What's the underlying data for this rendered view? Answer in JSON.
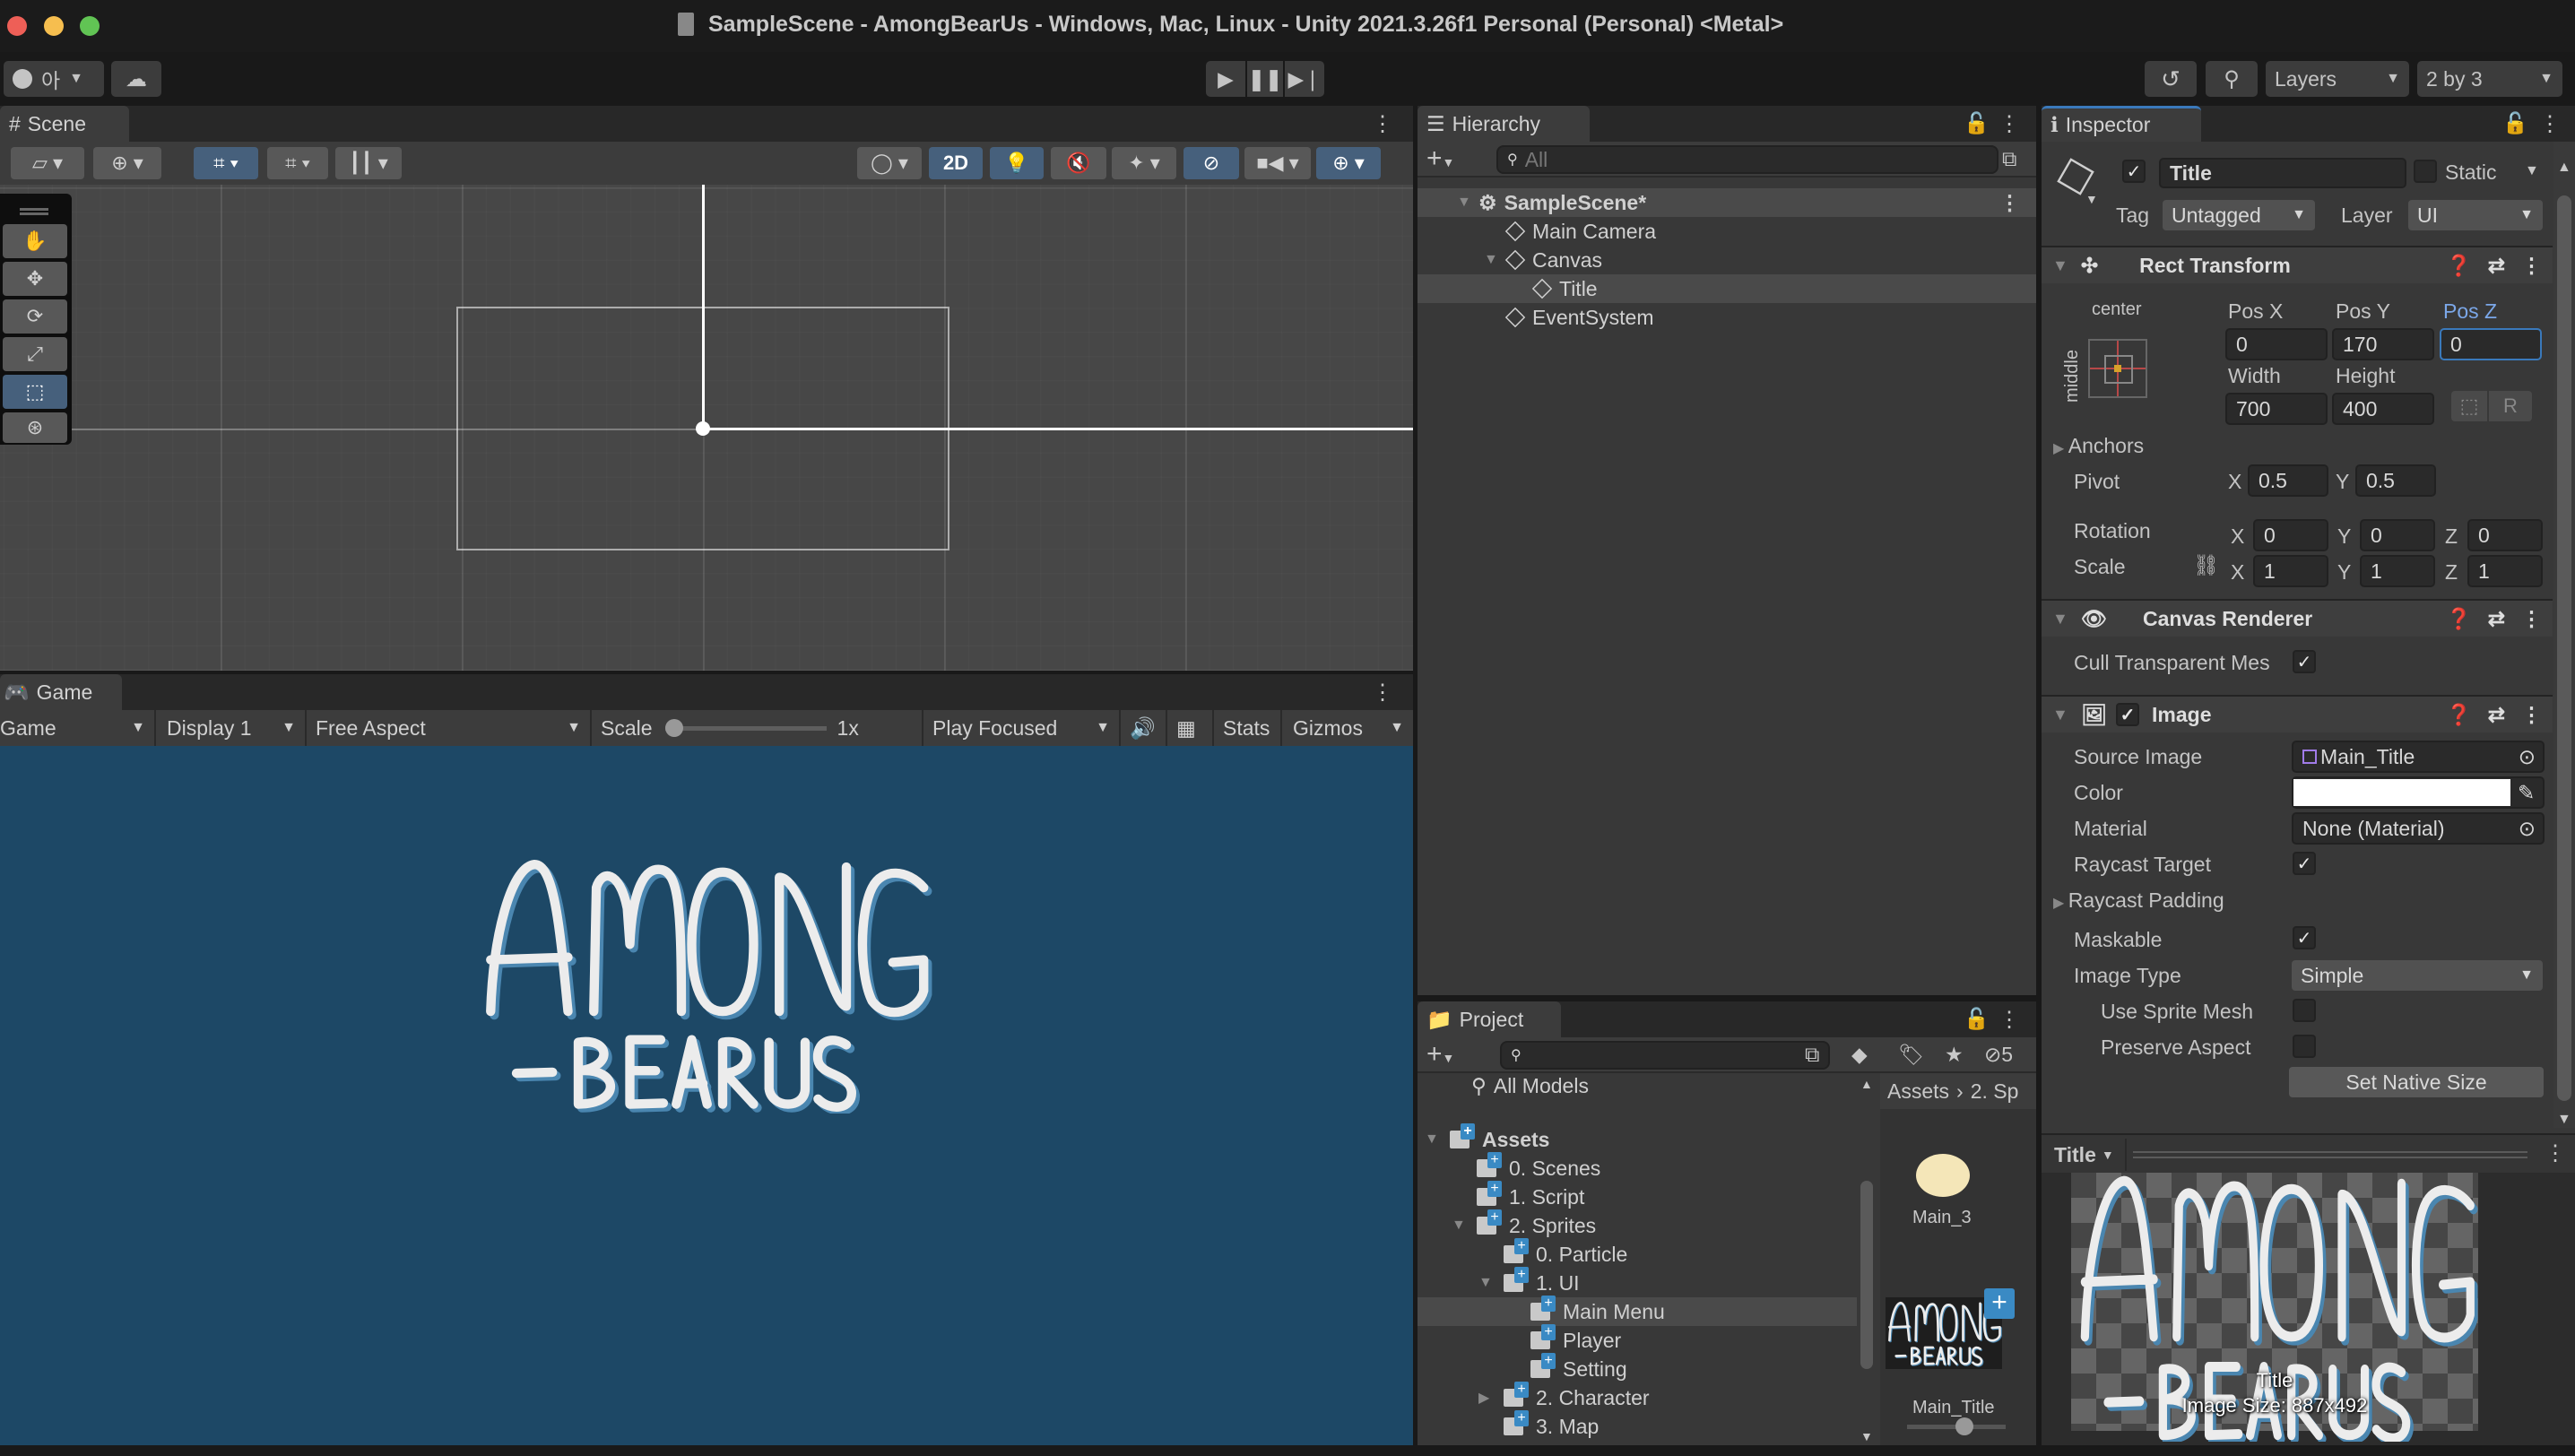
{
  "window": {
    "title": "SampleScene - AmongBearUs - Windows, Mac, Linux - Unity 2021.3.26f1 Personal (Personal) <Metal>"
  },
  "toolbar": {
    "account_label": "아",
    "layers": "Layers",
    "layout": "2 by 3"
  },
  "scene": {
    "tab": "Scene",
    "mode_2d": "2D"
  },
  "game": {
    "tab": "Game",
    "view_dropdown": "Game",
    "display": "Display 1",
    "aspect": "Free Aspect",
    "scale_label": "Scale",
    "scale_value": "1x",
    "scale_fraction": 0,
    "play_mode": "Play Focused",
    "stats": "Stats",
    "gizmos": "Gizmos",
    "background": "#1d4866",
    "logo_text": "AMONG -BEARUS"
  },
  "hierarchy": {
    "tab": "Hierarchy",
    "search_placeholder": "All",
    "items": [
      {
        "label": "SampleScene*",
        "depth": 0,
        "expanded": true,
        "type": "scene"
      },
      {
        "label": "Main Camera",
        "depth": 1,
        "type": "object"
      },
      {
        "label": "Canvas",
        "depth": 1,
        "expanded": true,
        "type": "object"
      },
      {
        "label": "Title",
        "depth": 2,
        "type": "object",
        "selected": true
      },
      {
        "label": "EventSystem",
        "depth": 1,
        "type": "object"
      }
    ]
  },
  "project": {
    "tab": "Project",
    "hidden_count": "5",
    "favorites": "All Models",
    "tree": [
      {
        "label": "Assets",
        "depth": 0,
        "expanded": true,
        "bold": true
      },
      {
        "label": "0. Scenes",
        "depth": 1
      },
      {
        "label": "1. Script",
        "depth": 1
      },
      {
        "label": "2. Sprites",
        "depth": 1,
        "expanded": true
      },
      {
        "label": "0. Particle",
        "depth": 2
      },
      {
        "label": "1. UI",
        "depth": 2,
        "expanded": true
      },
      {
        "label": "Main Menu",
        "depth": 3,
        "selected": true
      },
      {
        "label": "Player",
        "depth": 3
      },
      {
        "label": "Setting",
        "depth": 3
      },
      {
        "label": "2. Character",
        "depth": 2,
        "collapsed": true
      },
      {
        "label": "3. Map",
        "depth": 2
      }
    ],
    "breadcrumb": [
      "Assets",
      "2. Sp"
    ],
    "assets": [
      {
        "label": "Main_3"
      },
      {
        "label": "Main_Title"
      }
    ]
  },
  "inspector": {
    "tab": "Inspector",
    "object_name": "Title",
    "active": true,
    "static_label": "Static",
    "tag_label": "Tag",
    "tag": "Untagged",
    "layer_label": "Layer",
    "layer": "UI",
    "rect_transform": {
      "title": "Rect Transform",
      "anchor_h": "center",
      "anchor_v": "middle",
      "pos_x_label": "Pos X",
      "pos_x": "0",
      "pos_y_label": "Pos Y",
      "pos_y": "170",
      "pos_z_label": "Pos Z",
      "pos_z": "0",
      "width_label": "Width",
      "width": "700",
      "height_label": "Height",
      "height": "400",
      "r_button": "R",
      "anchors": "Anchors",
      "pivot": "Pivot",
      "pivot_x": "0.5",
      "pivot_y": "0.5",
      "rotation": "Rotation",
      "rot_x": "0",
      "rot_y": "0",
      "rot_z": "0",
      "scale": "Scale",
      "scale_x": "1",
      "scale_y": "1",
      "scale_z": "1",
      "x": "X",
      "y": "Y",
      "z": "Z"
    },
    "canvas_renderer": {
      "title": "Canvas Renderer",
      "cull_label": "Cull Transparent Mes",
      "cull": true
    },
    "image": {
      "title": "Image",
      "enabled": true,
      "source_label": "Source Image",
      "source": "Main_Title",
      "color_label": "Color",
      "color": "#ffffff",
      "material_label": "Material",
      "material": "None (Material)",
      "raycast_target_label": "Raycast Target",
      "raycast_target": true,
      "raycast_padding": "Raycast Padding",
      "maskable_label": "Maskable",
      "maskable": true,
      "image_type_label": "Image Type",
      "image_type": "Simple",
      "use_sprite_mesh_label": "Use Sprite Mesh",
      "use_sprite_mesh": false,
      "preserve_aspect_label": "Preserve Aspect",
      "preserve_aspect": false,
      "set_native_size": "Set Native Size"
    },
    "preview": {
      "dropdown": "Title",
      "name": "Title",
      "size": "Image Size: 887x492"
    }
  }
}
